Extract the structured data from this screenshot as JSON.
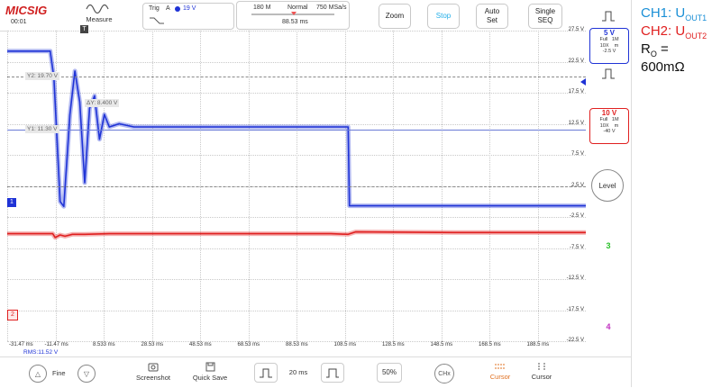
{
  "header": {
    "logo": "MICSIG",
    "time": "00:01",
    "measure_label": "Measure",
    "trig_label": "Trig",
    "trig_source": "A",
    "trig_level": "19 V",
    "mem_depth": "180 M",
    "mode": "Normal",
    "sample_rate": "750 MSa/s",
    "timebase_offset": "88.53 ms",
    "zoom_label": "Zoom",
    "stop_label": "Stop",
    "autoset_label": "Auto\nSet",
    "single_label": "Single\nSEQ"
  },
  "colors": {
    "ch1": "#1f33d6",
    "ch2": "#e02020",
    "ch3": "#2bc02b",
    "ch4": "#c030c0",
    "stop": "#22aee8"
  },
  "plot": {
    "y_ticks": [
      "27.5 V",
      "22.5 V",
      "17.5 V",
      "12.5 V",
      "7.5 V",
      "2.5 V",
      "-2.5 V",
      "-7.5 V",
      "-12.5 V",
      "-17.5 V",
      "-22.5 V"
    ],
    "x_ticks": [
      "-31.47 ms",
      "-11.47 ms",
      "8.533 ms",
      "28.53 ms",
      "48.53 ms",
      "68.53 ms",
      "88.53 ms",
      "108.5 ms",
      "128.5 ms",
      "148.5 ms",
      "168.5 ms",
      "188.5 ms"
    ],
    "cursor_y2": "Y2: 19.70 V",
    "cursor_y1": "Y1: 11.30 V",
    "delta_y": "ΔY: 8.400 V",
    "rms": "RMS:11.52 V",
    "ch1_marker": "1",
    "ch2_marker": "2",
    "trigger_marker": "T"
  },
  "chart_data": {
    "type": "line",
    "xlabel": "",
    "ylabel": "",
    "xlim": [
      -31.47,
      203.5
    ],
    "ylim": [
      -22.5,
      27.5
    ],
    "series": [
      {
        "name": "CH1",
        "x": [
          -31.47,
          -14,
          -12.5,
          -10,
          -8.5,
          -6,
          -4,
          -2,
          0,
          2,
          4,
          6,
          8,
          10,
          14,
          20,
          40,
          80,
          107,
          107.5,
          150,
          203.5
        ],
        "y": [
          24.2,
          24.2,
          20,
          0,
          -0.8,
          14,
          21,
          16,
          3,
          15,
          17,
          10,
          14,
          12,
          12.5,
          12,
          12,
          12,
          12,
          -0.7,
          -0.7,
          -0.7
        ]
      },
      {
        "name": "CH2",
        "x": [
          -31.47,
          -13,
          -12,
          -10,
          -8,
          -5,
          0,
          10,
          50,
          100,
          107,
          110,
          150,
          203.5
        ],
        "y": [
          -5.2,
          -5.2,
          -5.8,
          -5.4,
          -5.6,
          -5.3,
          -5.3,
          -5.2,
          -5.2,
          -5.2,
          -5.3,
          -4.9,
          -5.0,
          -5.0
        ]
      }
    ]
  },
  "right_panel": {
    "ch1_volts": "5 V",
    "ch1_info": "Full   1M\n10X    m\n-2.5 V",
    "ch2_volts": "10 V",
    "ch2_info": "Full   1M\n10X    m\n-40 V",
    "level_label": "Level",
    "ch3_label": "3",
    "ch4_label": "4"
  },
  "legend": {
    "ch1_text": "CH1: U",
    "ch1_sub": "OUT1",
    "ch2_text": "CH2: U",
    "ch2_sub": "OUT2",
    "ro_text": "R",
    "ro_sub": "O",
    "ro_eq": " =",
    "ro_value": "600mΩ"
  },
  "footer": {
    "fine_label": "Fine",
    "screenshot_label": "Screenshot",
    "quicksave_label": "Quick Save",
    "timebase": "20 ms",
    "percent": "50%",
    "chx_label": "CHx",
    "cursor1_label": "Cursor",
    "cursor2_label": "Cursor"
  }
}
